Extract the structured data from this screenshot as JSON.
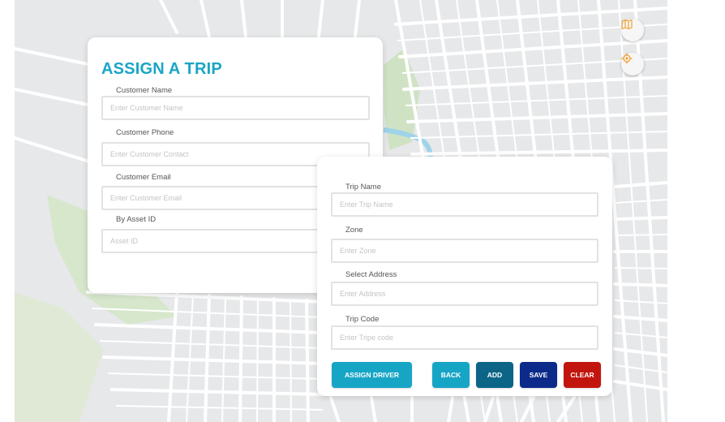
{
  "assign_form": {
    "title": "ASSIGN A TRIP",
    "customer_name": {
      "label": "Customer Name",
      "placeholder": "Enter Customer Name"
    },
    "customer_phone": {
      "label": "Customer Phone",
      "placeholder": "Enter Customer Contact"
    },
    "customer_email": {
      "label": "Customer Email",
      "placeholder": "Enter Customer Email"
    },
    "asset_id": {
      "label": "By Asset ID",
      "placeholder": "Asset ID"
    }
  },
  "trip_form": {
    "trip_name": {
      "label": "Trip Name",
      "placeholder": "Enter Trip Name"
    },
    "zone": {
      "label": "Zone",
      "placeholder": "Enter Zone"
    },
    "address": {
      "label": "Select Address",
      "placeholder": "Enter Address"
    },
    "trip_code": {
      "label": "Trip Code",
      "placeholder": "Enter Tripe code"
    }
  },
  "buttons": {
    "assign_driver": "ASSIGN DRIVER",
    "back": "BACK",
    "add": "ADD",
    "save": "SAVE",
    "clear": "CLEAR"
  },
  "map_controls": {
    "layers_icon": "map-icon",
    "locate_icon": "crosshair-icon"
  },
  "colors": {
    "accent": "#1aa6c6",
    "assign_driver": "#17a5c5",
    "back": "#17a5c5",
    "add": "#0c6586",
    "save": "#0c2a8a",
    "clear": "#c2150e",
    "map_icon": "#f0a030"
  }
}
